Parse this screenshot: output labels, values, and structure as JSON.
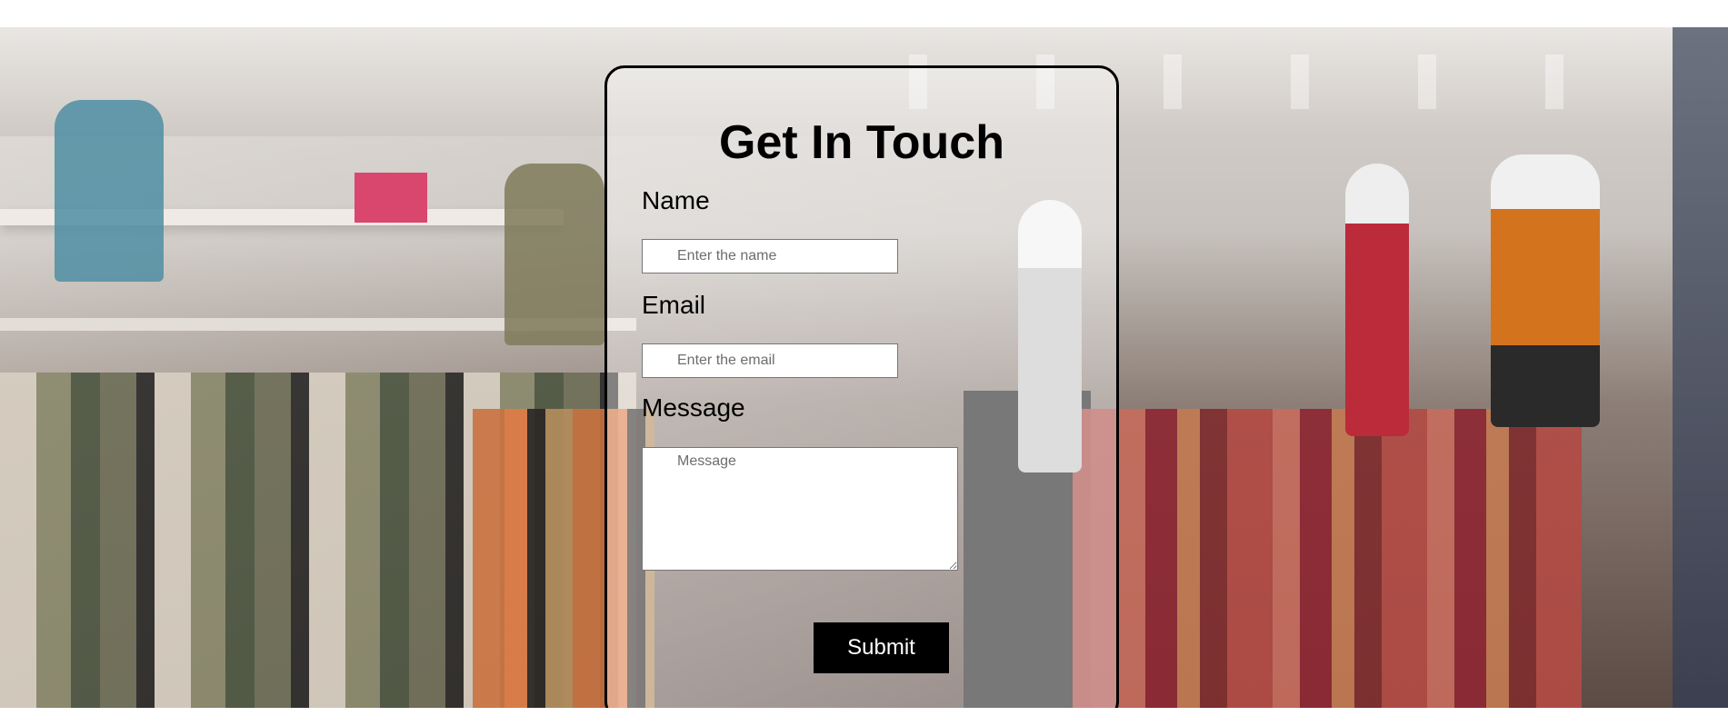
{
  "contact_form": {
    "title": "Get In Touch",
    "name_label": "Name",
    "name_placeholder": "Enter the name",
    "email_label": "Email",
    "email_placeholder": "Enter the email",
    "message_label": "Message",
    "message_placeholder": "Message",
    "submit_label": "Submit"
  },
  "colors": {
    "card_border": "#000000",
    "button_background": "#000000",
    "button_text": "#ffffff"
  }
}
